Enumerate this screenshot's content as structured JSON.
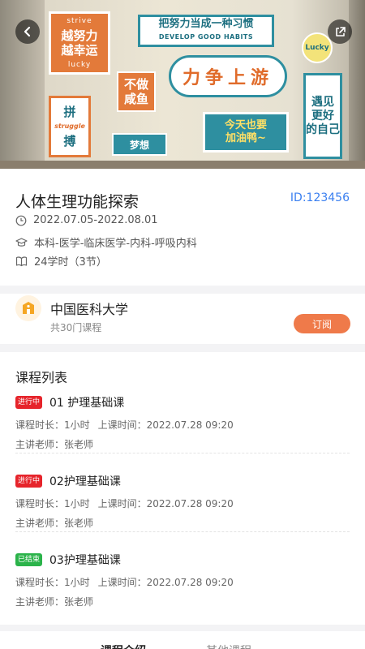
{
  "hero": {
    "signs": {
      "s1_top": "strive",
      "s1_line1": "越努力",
      "s1_line2": "越幸运",
      "s1_bottom": "lucky",
      "s2_line1": "把努力当成一种习惯",
      "s2_line2": "DEVELOP GOOD HABITS",
      "s3": "Lucky",
      "s4_line1": "不做",
      "s4_line2": "咸鱼",
      "s5": "力争上游",
      "s6_line1": "拼",
      "s6_mid": "struggle",
      "s6_line2": "搏",
      "s7": "梦想",
      "s8_line1": "今天也要",
      "s8_line2": "加油鸭~",
      "s9_line1": "遇见",
      "s9_line2": "更好",
      "s9_line3": "的自己"
    }
  },
  "course": {
    "title": "人体生理功能探索",
    "id": "ID:123456",
    "date_range": "2022.07.05-2022.08.01",
    "category": "本科-医学-临床医学-内科-呼吸内科",
    "hours": "24学时（3节）"
  },
  "university": {
    "name": "中国医科大学",
    "course_count": "共30门课程",
    "subscribe_label": "订阅"
  },
  "lessons": {
    "section_title": "课程列表",
    "items": [
      {
        "status": "进行中",
        "name": "01 护理基础课",
        "duration": "课程时长：1小时",
        "time": "上课时间：2022.07.28 09:20",
        "teacher": "主讲老师：张老师"
      },
      {
        "status": "进行中",
        "name": "02护理基础课",
        "duration": "课程时长：1小时",
        "time": "上课时间：2022.07.28 09:20",
        "teacher": "主讲老师：张老师"
      },
      {
        "status": "已结束",
        "name": "03护理基础课",
        "duration": "课程时长：1小时",
        "time": "上课时间：2022.07.28 09:20",
        "teacher": "主讲老师：张老师"
      }
    ]
  },
  "tabs": {
    "intro": "课程介绍",
    "other": "其他课程"
  },
  "colors": {
    "accent_blue": "#3a7ff0",
    "subscribe_orange": "#ef7a4a",
    "status_live": "#e6242b",
    "status_done": "#2bb34a"
  }
}
